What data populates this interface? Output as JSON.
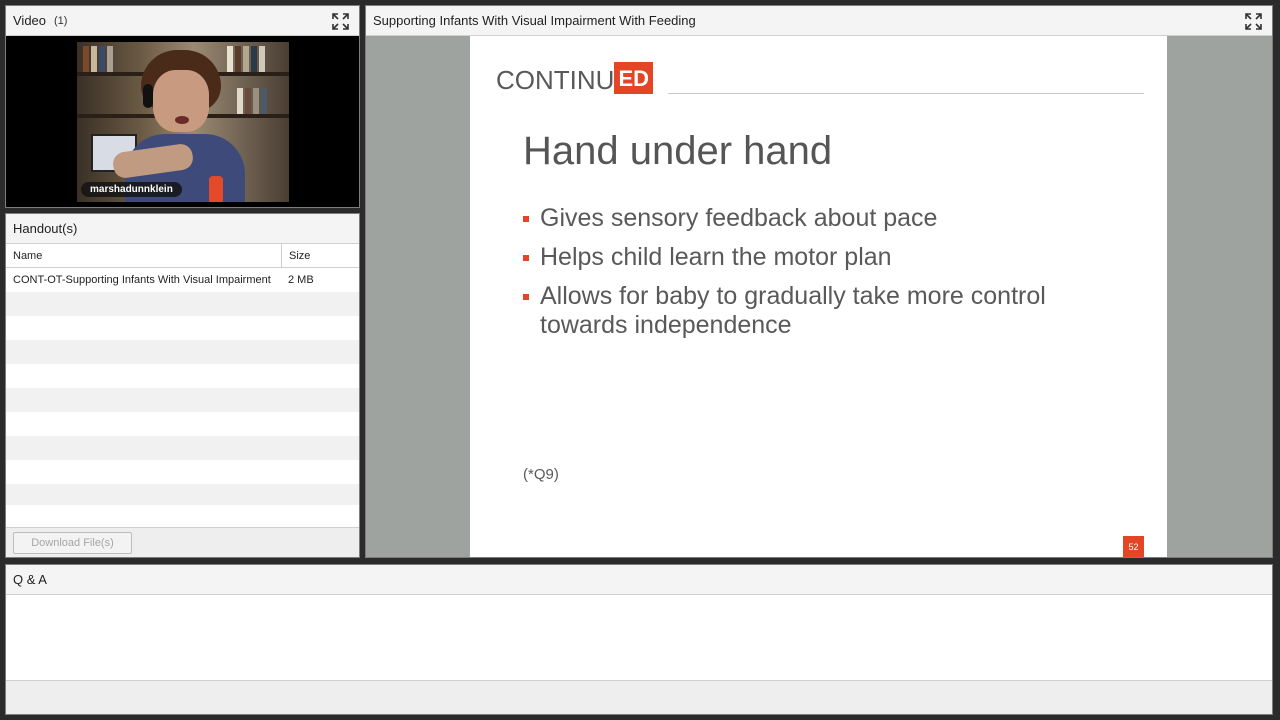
{
  "video": {
    "title": "Video",
    "count": "(1)",
    "presenter_name": "marshadunnklein"
  },
  "handouts": {
    "title": "Handout(s)",
    "columns": [
      "Name",
      "Size"
    ],
    "files": [
      {
        "name": "CONT-OT-Supporting Infants With Visual Impairment",
        "size": "2 MB"
      }
    ],
    "download_label": "Download File(s)"
  },
  "share": {
    "title": "Supporting Infants With Visual Impairment With Feeding",
    "slide": {
      "logo_part1": "CONTINU",
      "logo_part2": "ED",
      "heading": "Hand under hand",
      "bullets": [
        "Gives sensory feedback about pace",
        "Helps child learn the motor plan",
        "Allows for baby to gradually take more control towards independence"
      ],
      "note": "(*Q9)",
      "page_number": "52"
    }
  },
  "qa": {
    "title": "Q & A"
  },
  "icons": {
    "fullscreen": "fullscreen-icon"
  },
  "colors": {
    "accent": "#e34526",
    "slide_text": "#595959",
    "share_background": "#9fa39f"
  }
}
